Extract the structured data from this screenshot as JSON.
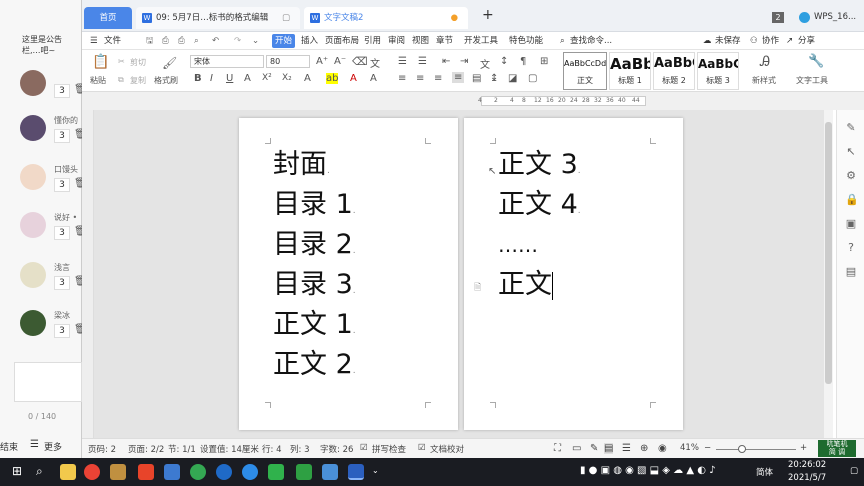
{
  "left_panel": {
    "notice": "这里是公告栏,…吧~",
    "chats": [
      {
        "name": "",
        "count": "3"
      },
      {
        "name": "懂你的",
        "count": "3"
      },
      {
        "name": "口馒头",
        "count": "3"
      },
      {
        "name": "说好 •",
        "count": "3"
      },
      {
        "name": "浅言",
        "count": "3"
      },
      {
        "name": "梁冰",
        "count": "3"
      }
    ],
    "char_count": "0 / 140",
    "end_label": "结束",
    "more_label": "更多"
  },
  "tabs": {
    "home": "首页",
    "doc1": "09: 5月7日…标书的格式编辑",
    "doc2": "文字文稿2",
    "add": "+",
    "badge": "2",
    "account": "WPS_16..."
  },
  "menu": {
    "file": "文件",
    "items": [
      "开始",
      "插入",
      "页面布局",
      "引用",
      "审阅",
      "视图",
      "章节",
      "开发工具",
      "特色功能"
    ],
    "search": "查找命令...",
    "unsaved": "未保存",
    "collab": "协作",
    "share": "分享"
  },
  "ribbon": {
    "paste": "粘贴",
    "cut": "剪切",
    "copy": "复制",
    "format_painter": "格式刷",
    "font_name": "宋体",
    "font_size": "80",
    "styles": [
      {
        "preview": "AaBbCcDd",
        "name": "正文"
      },
      {
        "preview": "AaBb",
        "name": "标题 1"
      },
      {
        "preview": "AaBbC",
        "name": "标题 2"
      },
      {
        "preview": "AaBbC",
        "name": "标题 3"
      }
    ],
    "new_style": "新样式",
    "text_tools": "文字工具"
  },
  "ruler": {
    "ticks": [
      "4",
      "2",
      "4",
      "8",
      "12",
      "16",
      "20",
      "24",
      "28",
      "32",
      "36",
      "40",
      "44"
    ]
  },
  "page1": {
    "lines": [
      "封面",
      "目录 1",
      "目录 2",
      "目录 3",
      "正文 1",
      "正文 2"
    ]
  },
  "page2": {
    "lines": [
      "正文 3",
      "正文 4",
      "……",
      "正文"
    ]
  },
  "status": {
    "page_num": "页码: 2",
    "page": "页面: 2/2",
    "section": "节: 1/1",
    "setting": "设置值: 14厘米",
    "row": "行: 4",
    "col": "列: 3",
    "words": "字数: 26",
    "spell": "拼写检查",
    "doc_check": "文档校对",
    "zoom": "41%"
  },
  "taskbar": {
    "time": "20:26:02",
    "date": "2021/5/7",
    "ime": "简体",
    "tray_title": "吭笔机",
    "tray_sub": "简 调"
  }
}
